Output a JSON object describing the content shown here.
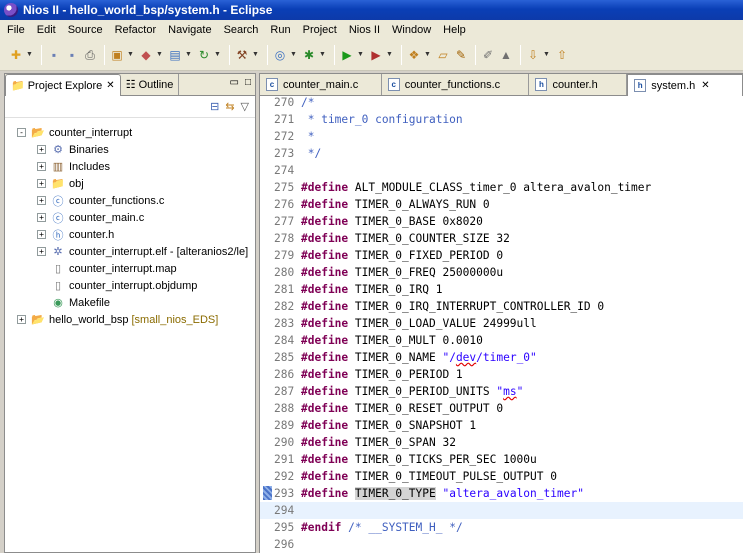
{
  "window": {
    "title": "Nios II - hello_world_bsp/system.h - Eclipse"
  },
  "menu": [
    "File",
    "Edit",
    "Source",
    "Refactor",
    "Navigate",
    "Search",
    "Run",
    "Project",
    "Nios II",
    "Window",
    "Help"
  ],
  "toolbar": {
    "icons": [
      "new-icon",
      "save-icon",
      "save-all-icon",
      "print-icon",
      "new-folder-icon",
      "new-class-icon",
      "new-source-icon",
      "refresh-icon",
      "build-icon",
      "target-icon",
      "debug-icon",
      "run-icon",
      "external-tools-icon",
      "open-type-icon",
      "open-folder-icon",
      "edit-icon",
      "toggle-mark-icon",
      "pin-icon",
      "next-annotation-icon",
      "prev-annotation-icon"
    ]
  },
  "left_panel": {
    "tabs": [
      {
        "label": "Project Explore",
        "active": true
      },
      {
        "label": "Outline",
        "active": false
      }
    ],
    "tree": [
      {
        "label": "counter_interrupt",
        "indent": 0,
        "toggle": "−",
        "icon": "project-icon"
      },
      {
        "label": "Binaries",
        "indent": 1,
        "toggle": "+",
        "icon": "binaries-icon"
      },
      {
        "label": "Includes",
        "indent": 1,
        "toggle": "+",
        "icon": "includes-icon"
      },
      {
        "label": "obj",
        "indent": 1,
        "toggle": "+",
        "icon": "folder-icon"
      },
      {
        "label": "counter_functions.c",
        "indent": 1,
        "toggle": "+",
        "icon": "c-file-icon"
      },
      {
        "label": "counter_main.c",
        "indent": 1,
        "toggle": "+",
        "icon": "c-file-icon"
      },
      {
        "label": "counter.h",
        "indent": 1,
        "toggle": "+",
        "icon": "h-file-icon"
      },
      {
        "label": "counter_interrupt.elf - [alteranios2/le]",
        "indent": 1,
        "toggle": "+",
        "icon": "elf-icon"
      },
      {
        "label": "counter_interrupt.map",
        "indent": 1,
        "toggle": "",
        "icon": "file-icon"
      },
      {
        "label": "counter_interrupt.objdump",
        "indent": 1,
        "toggle": "",
        "icon": "file-icon"
      },
      {
        "label": "Makefile",
        "indent": 1,
        "toggle": "",
        "icon": "makefile-icon"
      },
      {
        "label": "hello_world_bsp",
        "extra": "[small_nios_EDS]",
        "indent": 0,
        "toggle": "+",
        "icon": "project-icon"
      }
    ]
  },
  "editor": {
    "tabs": [
      {
        "label": "counter_main.c",
        "icon": "c",
        "active": false
      },
      {
        "label": "counter_functions.c",
        "icon": "c",
        "active": false
      },
      {
        "label": "counter.h",
        "icon": "h",
        "active": false
      },
      {
        "label": "system.h",
        "icon": "h",
        "active": true,
        "close": "✕"
      }
    ],
    "lines": [
      {
        "n": "270",
        "parts": [
          [
            "cm",
            "/*"
          ]
        ]
      },
      {
        "n": "271",
        "parts": [
          [
            "cm",
            " * timer_0 configuration"
          ]
        ]
      },
      {
        "n": "272",
        "parts": [
          [
            "cm",
            " *"
          ]
        ]
      },
      {
        "n": "273",
        "parts": [
          [
            "cm",
            " */"
          ]
        ]
      },
      {
        "n": "274",
        "parts": []
      },
      {
        "n": "275",
        "parts": [
          [
            "kw",
            "#define"
          ],
          [
            "",
            " ALT_MODULE_CLASS_timer_0 altera_avalon_timer"
          ]
        ]
      },
      {
        "n": "276",
        "parts": [
          [
            "kw",
            "#define"
          ],
          [
            "",
            " TIMER_0_ALWAYS_RUN 0"
          ]
        ]
      },
      {
        "n": "277",
        "parts": [
          [
            "kw",
            "#define"
          ],
          [
            "",
            " TIMER_0_BASE 0x8020"
          ]
        ]
      },
      {
        "n": "278",
        "parts": [
          [
            "kw",
            "#define"
          ],
          [
            "",
            " TIMER_0_COUNTER_SIZE 32"
          ]
        ]
      },
      {
        "n": "279",
        "parts": [
          [
            "kw",
            "#define"
          ],
          [
            "",
            " TIMER_0_FIXED_PERIOD 0"
          ]
        ]
      },
      {
        "n": "280",
        "parts": [
          [
            "kw",
            "#define"
          ],
          [
            "",
            " TIMER_0_FREQ 25000000u"
          ]
        ]
      },
      {
        "n": "281",
        "parts": [
          [
            "kw",
            "#define"
          ],
          [
            "",
            " TIMER_0_IRQ 1"
          ]
        ]
      },
      {
        "n": "282",
        "parts": [
          [
            "kw",
            "#define"
          ],
          [
            "",
            " TIMER_0_IRQ_INTERRUPT_CONTROLLER_ID 0"
          ]
        ]
      },
      {
        "n": "283",
        "parts": [
          [
            "kw",
            "#define"
          ],
          [
            "",
            " TIMER_0_LOAD_VALUE 24999ull"
          ]
        ]
      },
      {
        "n": "284",
        "parts": [
          [
            "kw",
            "#define"
          ],
          [
            "",
            " TIMER_0_MULT 0.0010"
          ]
        ]
      },
      {
        "n": "285",
        "parts": [
          [
            "kw",
            "#define"
          ],
          [
            "",
            " TIMER_0_NAME "
          ],
          [
            "str",
            "\"/"
          ],
          [
            "str err",
            "dev"
          ],
          [
            "str",
            "/timer_0\""
          ]
        ]
      },
      {
        "n": "286",
        "parts": [
          [
            "kw",
            "#define"
          ],
          [
            "",
            " TIMER_0_PERIOD 1"
          ]
        ]
      },
      {
        "n": "287",
        "parts": [
          [
            "kw",
            "#define"
          ],
          [
            "",
            " TIMER_0_PERIOD_UNITS "
          ],
          [
            "str",
            "\""
          ],
          [
            "str err",
            "ms"
          ],
          [
            "str",
            "\""
          ]
        ]
      },
      {
        "n": "288",
        "parts": [
          [
            "kw",
            "#define"
          ],
          [
            "",
            " TIMER_0_RESET_OUTPUT 0"
          ]
        ]
      },
      {
        "n": "289",
        "parts": [
          [
            "kw",
            "#define"
          ],
          [
            "",
            " TIMER_0_SNAPSHOT 1"
          ]
        ]
      },
      {
        "n": "290",
        "parts": [
          [
            "kw",
            "#define"
          ],
          [
            "",
            " TIMER_0_SPAN 32"
          ]
        ]
      },
      {
        "n": "291",
        "parts": [
          [
            "kw",
            "#define"
          ],
          [
            "",
            " TIMER_0_TICKS_PER_SEC 1000u"
          ]
        ]
      },
      {
        "n": "292",
        "parts": [
          [
            "kw",
            "#define"
          ],
          [
            "",
            " TIMER_0_TIMEOUT_PULSE_OUTPUT 0"
          ]
        ]
      },
      {
        "n": "293",
        "parts": [
          [
            "kw",
            "#define"
          ],
          [
            "",
            " "
          ],
          [
            "hl",
            "TIMER_0_TYPE"
          ],
          [
            "",
            " "
          ],
          [
            "str",
            "\"altera_avalon_timer\""
          ]
        ],
        "marker": true
      },
      {
        "n": "294",
        "parts": [],
        "current": true
      },
      {
        "n": "295",
        "parts": [
          [
            "kw",
            "#endif"
          ],
          [
            "",
            " "
          ],
          [
            "cm",
            "/* __SYSTEM_H_ */"
          ]
        ]
      },
      {
        "n": "296",
        "parts": []
      }
    ]
  }
}
